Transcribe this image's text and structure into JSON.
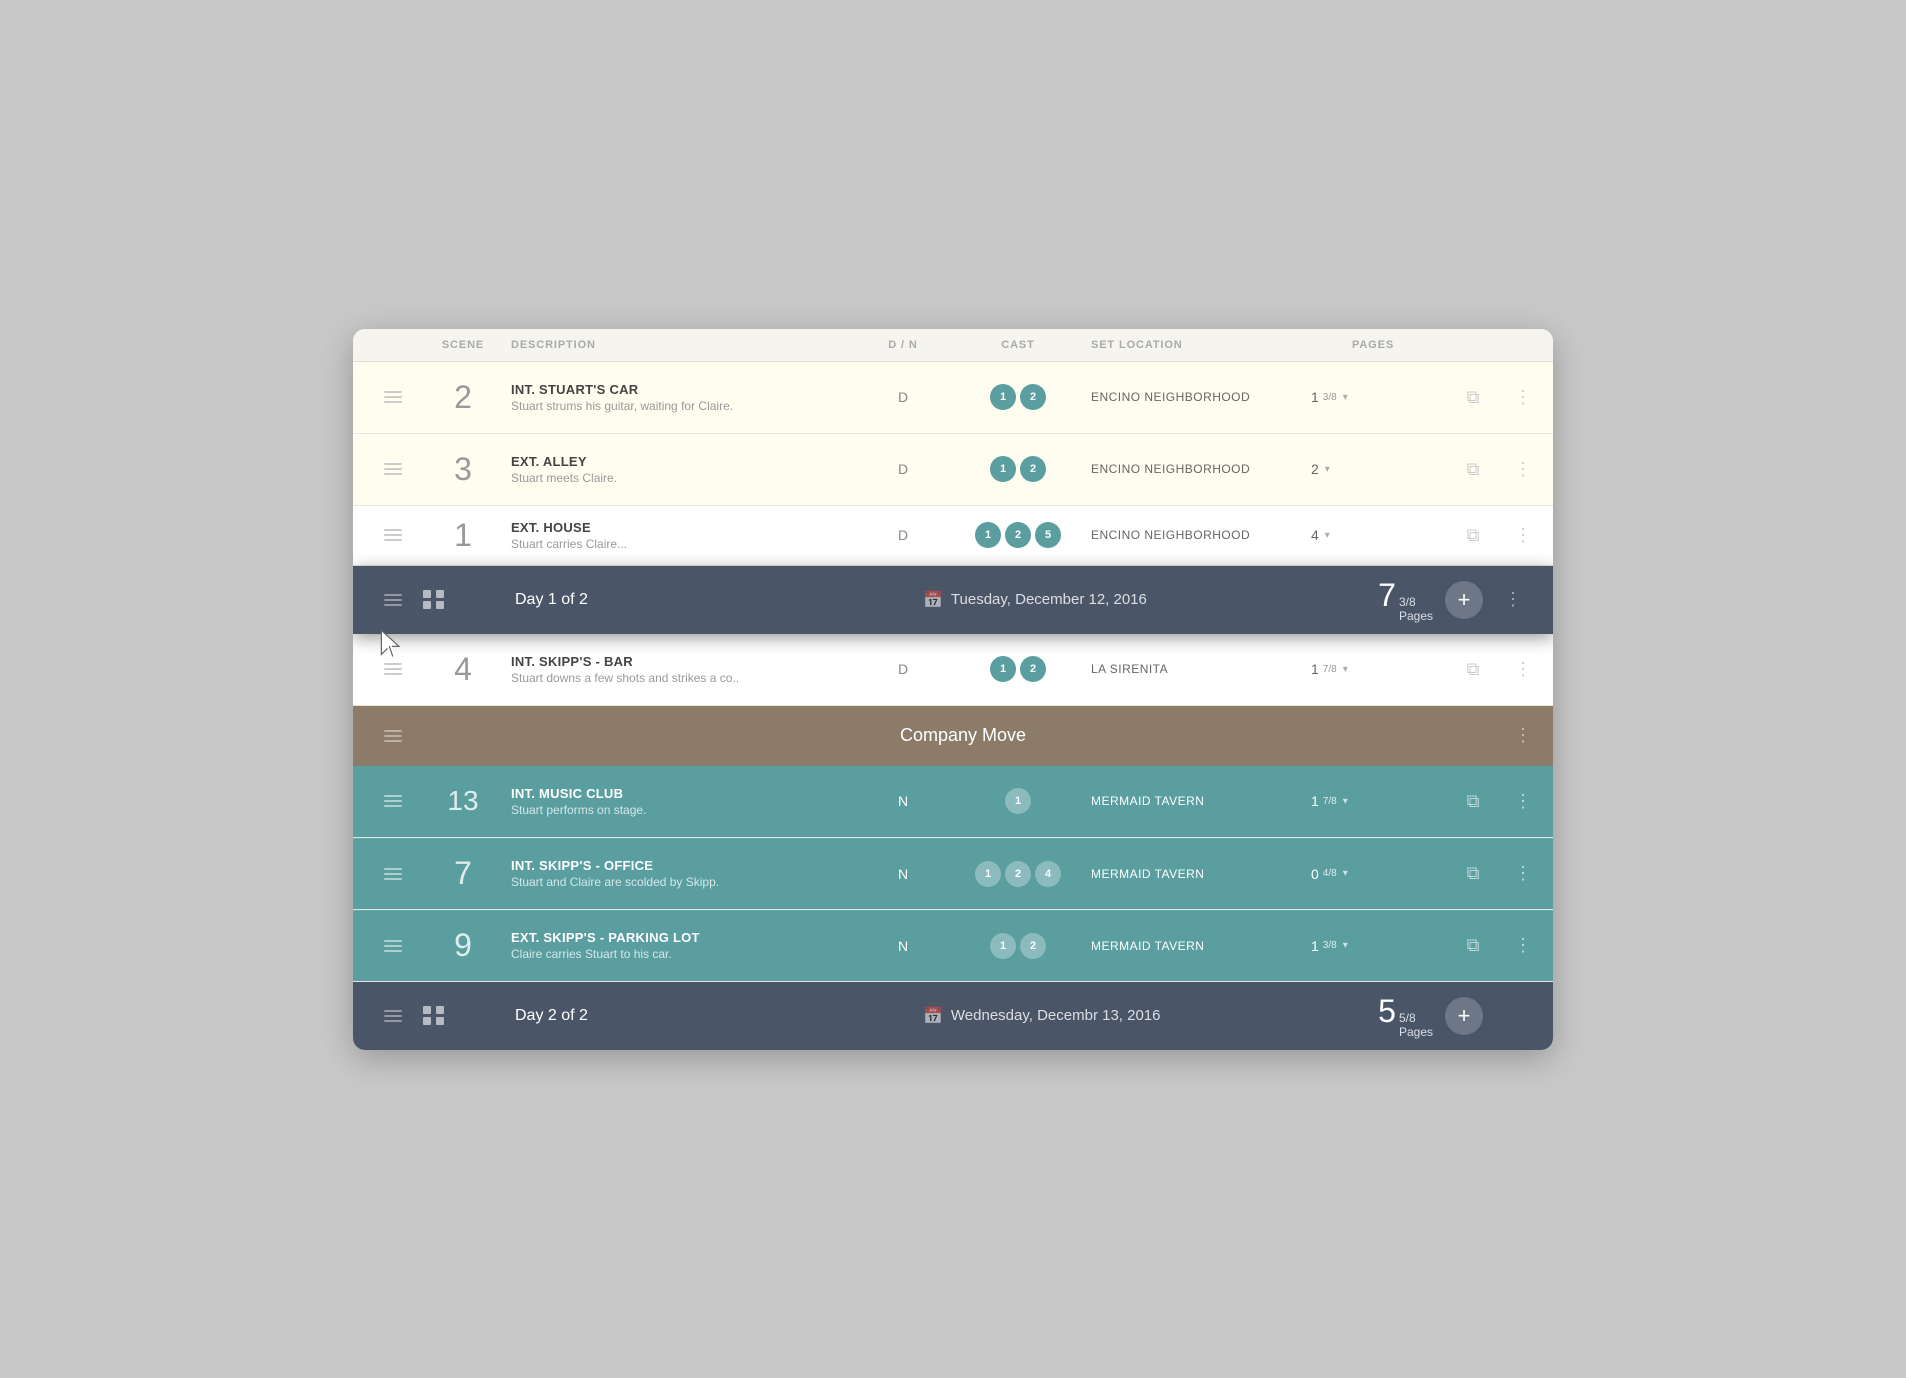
{
  "headers": {
    "scene": "SCENE",
    "description": "DESCRIPTION",
    "dm": "D / N",
    "cast": "CAST",
    "set_location": "SET LOCATION",
    "pages": "PAGES"
  },
  "scenes": [
    {
      "id": "scene-2",
      "num": "2",
      "title": "INT. STUART'S CAR",
      "desc": "Stuart strums his guitar, waiting for Claire.",
      "dm": "D",
      "cast": [
        "1",
        "2"
      ],
      "location": "ENCINO NEIGHBORHOOD",
      "pages_whole": "1",
      "pages_frac": "3/8",
      "rowType": "yellow"
    },
    {
      "id": "scene-3",
      "num": "3",
      "title": "EXT. ALLEY",
      "desc": "Stuart meets Claire.",
      "dm": "D",
      "cast": [
        "1",
        "2"
      ],
      "location": "ENCINO NEIGHBORHOOD",
      "pages_whole": "2",
      "pages_frac": "",
      "rowType": "yellow"
    },
    {
      "id": "scene-1",
      "num": "1",
      "title": "EXT. HOUSE",
      "desc": "...",
      "dm": "D",
      "cast": [
        "1",
        "2",
        "5"
      ],
      "location": "ENCINO NEIGHBORHOOD",
      "pages_whole": "4",
      "pages_frac": "",
      "rowType": "white"
    }
  ],
  "day1": {
    "label": "Day 1 of 2",
    "date": "Tuesday, December 12, 2016",
    "pages_whole": "7",
    "pages_frac": "3/8",
    "pages_label": "Pages"
  },
  "scene4": {
    "num": "4",
    "title": "INT. SKIPP'S - BAR",
    "desc": "Stuart downs a few shots and strikes a co..",
    "dm": "D",
    "cast": [
      "1",
      "2"
    ],
    "location": "LA SIRENITA",
    "pages_whole": "1",
    "pages_frac": "7/8",
    "rowType": "white"
  },
  "companyMove": {
    "label": "Company Move"
  },
  "tealScenes": [
    {
      "id": "scene-13",
      "num": "13",
      "title": "INT. MUSIC CLUB",
      "desc": "Stuart performs on stage.",
      "dm": "N",
      "cast": [
        "1"
      ],
      "location": "MERMAID TAVERN",
      "pages_whole": "1",
      "pages_frac": "7/8"
    },
    {
      "id": "scene-7",
      "num": "7",
      "title": "INT. SKIPP'S - OFFICE",
      "desc": "Stuart and Claire are scolded by Skipp.",
      "dm": "N",
      "cast": [
        "1",
        "2",
        "4"
      ],
      "location": "MERMAID TAVERN",
      "pages_whole": "0",
      "pages_frac": "4/8"
    },
    {
      "id": "scene-9",
      "num": "9",
      "title": "EXT. SKIPP'S - PARKING LOT",
      "desc": "Claire carries Stuart to his car.",
      "dm": "N",
      "cast": [
        "1",
        "2"
      ],
      "location": "MERMAID TAVERN",
      "pages_whole": "1",
      "pages_frac": "3/8"
    }
  ],
  "day2": {
    "label": "Day 2 of 2",
    "date": "Wednesday, Decembr 13, 2016",
    "pages_whole": "5",
    "pages_frac": "5/8",
    "pages_label": "Pages"
  },
  "colors": {
    "yellow_bg": "#fffdf0",
    "white_bg": "#ffffff",
    "teal_bg": "#5a9ea0",
    "day_header_bg": "#4a5568",
    "company_move_bg": "#8d7b6a"
  }
}
